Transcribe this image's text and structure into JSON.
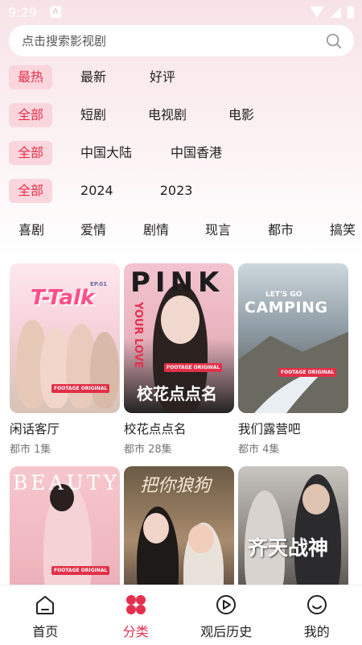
{
  "status": {
    "time": "9:29",
    "notif": "A"
  },
  "search": {
    "placeholder": "点击搜索影视剧"
  },
  "filters": {
    "sort": [
      "最热",
      "最新",
      "好评"
    ],
    "type": [
      "全部",
      "短剧",
      "电视剧",
      "电影"
    ],
    "region": [
      "全部",
      "中国大陆",
      "中国香港"
    ],
    "year": [
      "全部",
      "2024",
      "2023"
    ]
  },
  "genres": [
    "喜剧",
    "爱情",
    "剧情",
    "现言",
    "都市",
    "搞笑"
  ],
  "cards": [
    {
      "title": "闲话客厅",
      "meta": "都市 1集",
      "poster_text": "T-Talk",
      "poster_sub": "EP.01",
      "badge": "FOOTAGE ORIGINAL"
    },
    {
      "title": "校花点点名",
      "meta": "都市 28集",
      "poster_text": "校花点点名",
      "poster_top": "PINK",
      "poster_side": "YOUR LOVE",
      "badge": "FOOTAGE ORIGINAL"
    },
    {
      "title": "我们露营吧",
      "meta": "都市 4集",
      "poster_text": "CAMPING",
      "poster_top": "LET'S GO",
      "badge": "FOOTAGE ORIGINAL"
    },
    {
      "title": "",
      "meta": "",
      "poster_text": "BEAUTY",
      "badge": "FOOTAGE ORIGINAL"
    },
    {
      "title": "",
      "meta": "",
      "poster_text": "把你狼狗"
    },
    {
      "title": "",
      "meta": "",
      "poster_text": "齐天战神"
    }
  ],
  "nav": [
    {
      "label": "首页",
      "icon": "home-icon"
    },
    {
      "label": "分类",
      "icon": "category-icon"
    },
    {
      "label": "观后历史",
      "icon": "history-play-icon"
    },
    {
      "label": "我的",
      "icon": "profile-icon"
    }
  ],
  "colors": {
    "accent": "#e5304d",
    "chip_active_bg": "#fad6dc"
  }
}
